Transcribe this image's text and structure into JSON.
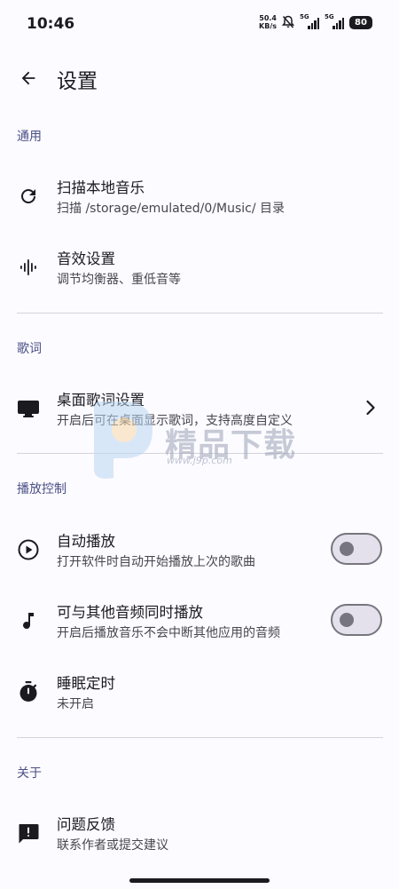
{
  "status": {
    "time": "10:46",
    "net_speed_value": "50.4",
    "net_speed_unit": "KB/s",
    "sim1": "5G",
    "sim2": "5G",
    "battery": "80"
  },
  "header": {
    "title": "设置"
  },
  "sections": {
    "general": {
      "title": "通用",
      "scan": {
        "title": "扫描本地音乐",
        "subtitle": "扫描 /storage/emulated/0/Music/ 目录",
        "icon": "refresh-icon"
      },
      "sound": {
        "title": "音效设置",
        "subtitle": "调节均衡器、重低音等",
        "icon": "waveform-icon"
      }
    },
    "lyrics": {
      "title": "歌词",
      "desktop": {
        "title": "桌面歌词设置",
        "subtitle": "开启后可在桌面显示歌词，支持高度自定义",
        "icon": "monitor-icon"
      }
    },
    "playback": {
      "title": "播放控制",
      "autoplay": {
        "title": "自动播放",
        "subtitle": "打开软件时自动开始播放上次的歌曲",
        "icon": "play-circle-icon",
        "enabled": false
      },
      "mix": {
        "title": "可与其他音频同时播放",
        "subtitle": "开启后播放音乐不会中断其他应用的音频",
        "icon": "music-note-icon",
        "enabled": false
      },
      "sleep": {
        "title": "睡眠定时",
        "subtitle": "未开启",
        "icon": "timer-icon"
      }
    },
    "about": {
      "title": "关于",
      "feedback": {
        "title": "问题反馈",
        "subtitle": "联系作者或提交建议",
        "icon": "feedback-icon"
      }
    }
  },
  "watermark": {
    "text": "精品下载",
    "url": "www.j9p.com"
  },
  "colors": {
    "accent": "#4a4f86",
    "background": "#fcfbff",
    "divider": "#d4d2dc"
  }
}
